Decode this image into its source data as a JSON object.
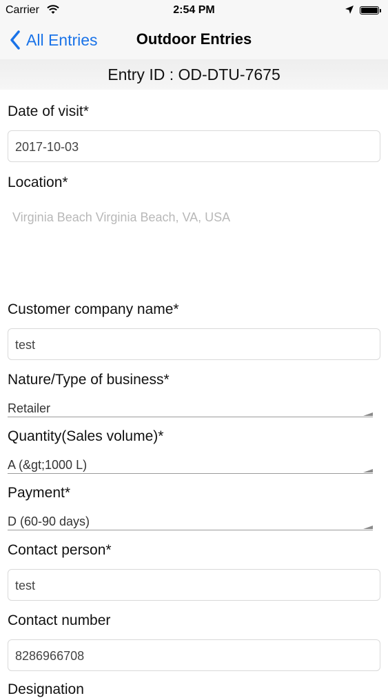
{
  "status_bar": {
    "carrier": "Carrier",
    "time": "2:54 PM"
  },
  "nav": {
    "back_label": "All Entries",
    "title": "Outdoor Entries",
    "accent_color": "#1a73e8"
  },
  "entry_id": "Entry ID : OD-DTU-7675",
  "form": {
    "date_label": "Date of visit*",
    "date_value": "2017-10-03",
    "location_label": "Location*",
    "location_value": "Virginia Beach Virginia Beach, VA, USA",
    "company_label": "Customer company name*",
    "company_value": "test",
    "business_label": "Nature/Type of business*",
    "business_value": "Retailer",
    "quantity_label": "Quantity(Sales volume)*",
    "quantity_value": "A (&gt;1000 L)",
    "payment_label": "Payment*",
    "payment_value": "D (60-90 days)",
    "contact_person_label": "Contact person*",
    "contact_person_value": "test",
    "contact_number_label": "Contact number",
    "contact_number_value": "8286966708",
    "designation_label": "Designation"
  }
}
